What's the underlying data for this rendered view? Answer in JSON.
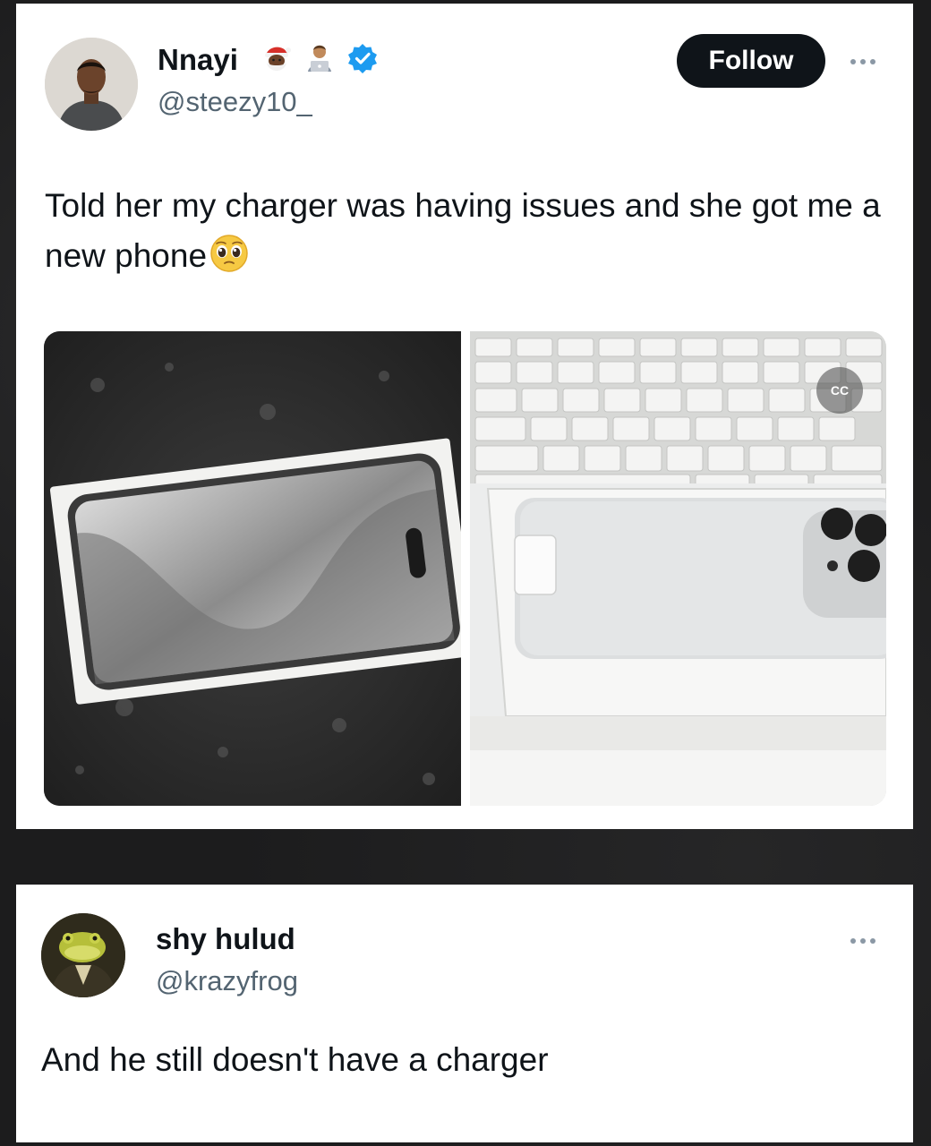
{
  "tweet": {
    "author": {
      "name": "Nnayi",
      "handle": "@steezy10_",
      "badges": [
        "santa-emoji",
        "technologist-emoji",
        "verified-badge-icon"
      ]
    },
    "follow_label": "Follow",
    "text": "Told her my charger was having issues and she got me a new phone",
    "text_emoji": "pleading-face-emoji",
    "media": [
      {
        "description_icon": "iphone-box-photo"
      },
      {
        "description_icon": "iphone-in-box-photo",
        "badge": "CC"
      }
    ]
  },
  "reply": {
    "author": {
      "name": "shy hulud",
      "handle": "@krazyfrog"
    },
    "text": "And he still doesn't have a charger"
  },
  "colors": {
    "text_primary": "#0f1419",
    "text_secondary": "#536471",
    "verified": "#1d9bf0",
    "button_bg": "#0f1419",
    "background": "#1c1c1d"
  }
}
